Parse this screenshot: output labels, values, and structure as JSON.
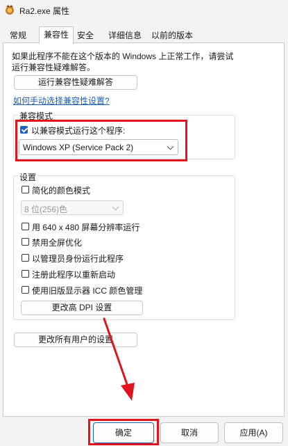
{
  "window": {
    "title": "Ra2.exe 属性"
  },
  "tabs": [
    {
      "label": "常规"
    },
    {
      "label": "兼容性"
    },
    {
      "label": "安全"
    },
    {
      "label": "详细信息"
    },
    {
      "label": "以前的版本"
    }
  ],
  "intro": {
    "line1": "如果此程序不能在这个版本的 Windows 上正常工作，请尝试",
    "line2": "运行兼容性疑难解答。"
  },
  "troubleshooter_button": "运行兼容性疑难解答",
  "manual_link": "如何手动选择兼容性设置?",
  "compat_mode": {
    "legend": "兼容模式",
    "checkbox_label": "以兼容模式运行这个程序:",
    "checked": true,
    "selected_os": "Windows XP (Service Pack 2)"
  },
  "settings": {
    "legend": "设置",
    "reduced_color": {
      "label": "简化的颜色模式",
      "checked": false
    },
    "color_select": "8 位(256)色",
    "res640": {
      "label": "用 640 x 480 屏幕分辨率运行",
      "checked": false
    },
    "disable_fullscreen": {
      "label": "禁用全屏优化",
      "checked": false
    },
    "run_admin": {
      "label": "以管理员身份运行此程序",
      "checked": false
    },
    "register_restart": {
      "label": "注册此程序以重新启动",
      "checked": false
    },
    "legacy_icc": {
      "label": "使用旧版显示器 ICC 颜色管理",
      "checked": false
    },
    "dpi_button": "更改高 DPI 设置"
  },
  "all_users_button": "更改所有用户的设置",
  "buttons": {
    "ok": "确定",
    "cancel": "取消",
    "apply": "应用(A)"
  },
  "colors": {
    "highlight": "#e0141c",
    "accent": "#1a64c0",
    "link": "#1a5fb4"
  }
}
